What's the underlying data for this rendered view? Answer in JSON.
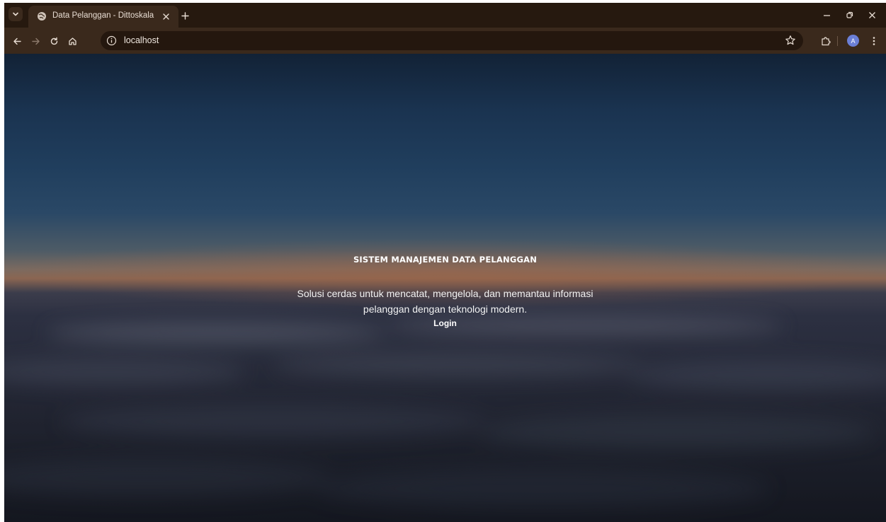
{
  "browser": {
    "tab": {
      "title": "Data Pelanggan - Dittoskala"
    },
    "address_bar": {
      "url": "localhost"
    },
    "profile": {
      "initial": "A"
    }
  },
  "hero": {
    "title": "SISTEM MANAJEMEN DATA PELANGGAN",
    "subtitle": "Solusi cerdas untuk mencatat, mengelola, dan memantau informasi pelanggan dengan teknologi modern.",
    "login_label": "Login"
  },
  "colors": {
    "accent_avatar": "#6b7fd6",
    "frame": "#3a291c"
  }
}
